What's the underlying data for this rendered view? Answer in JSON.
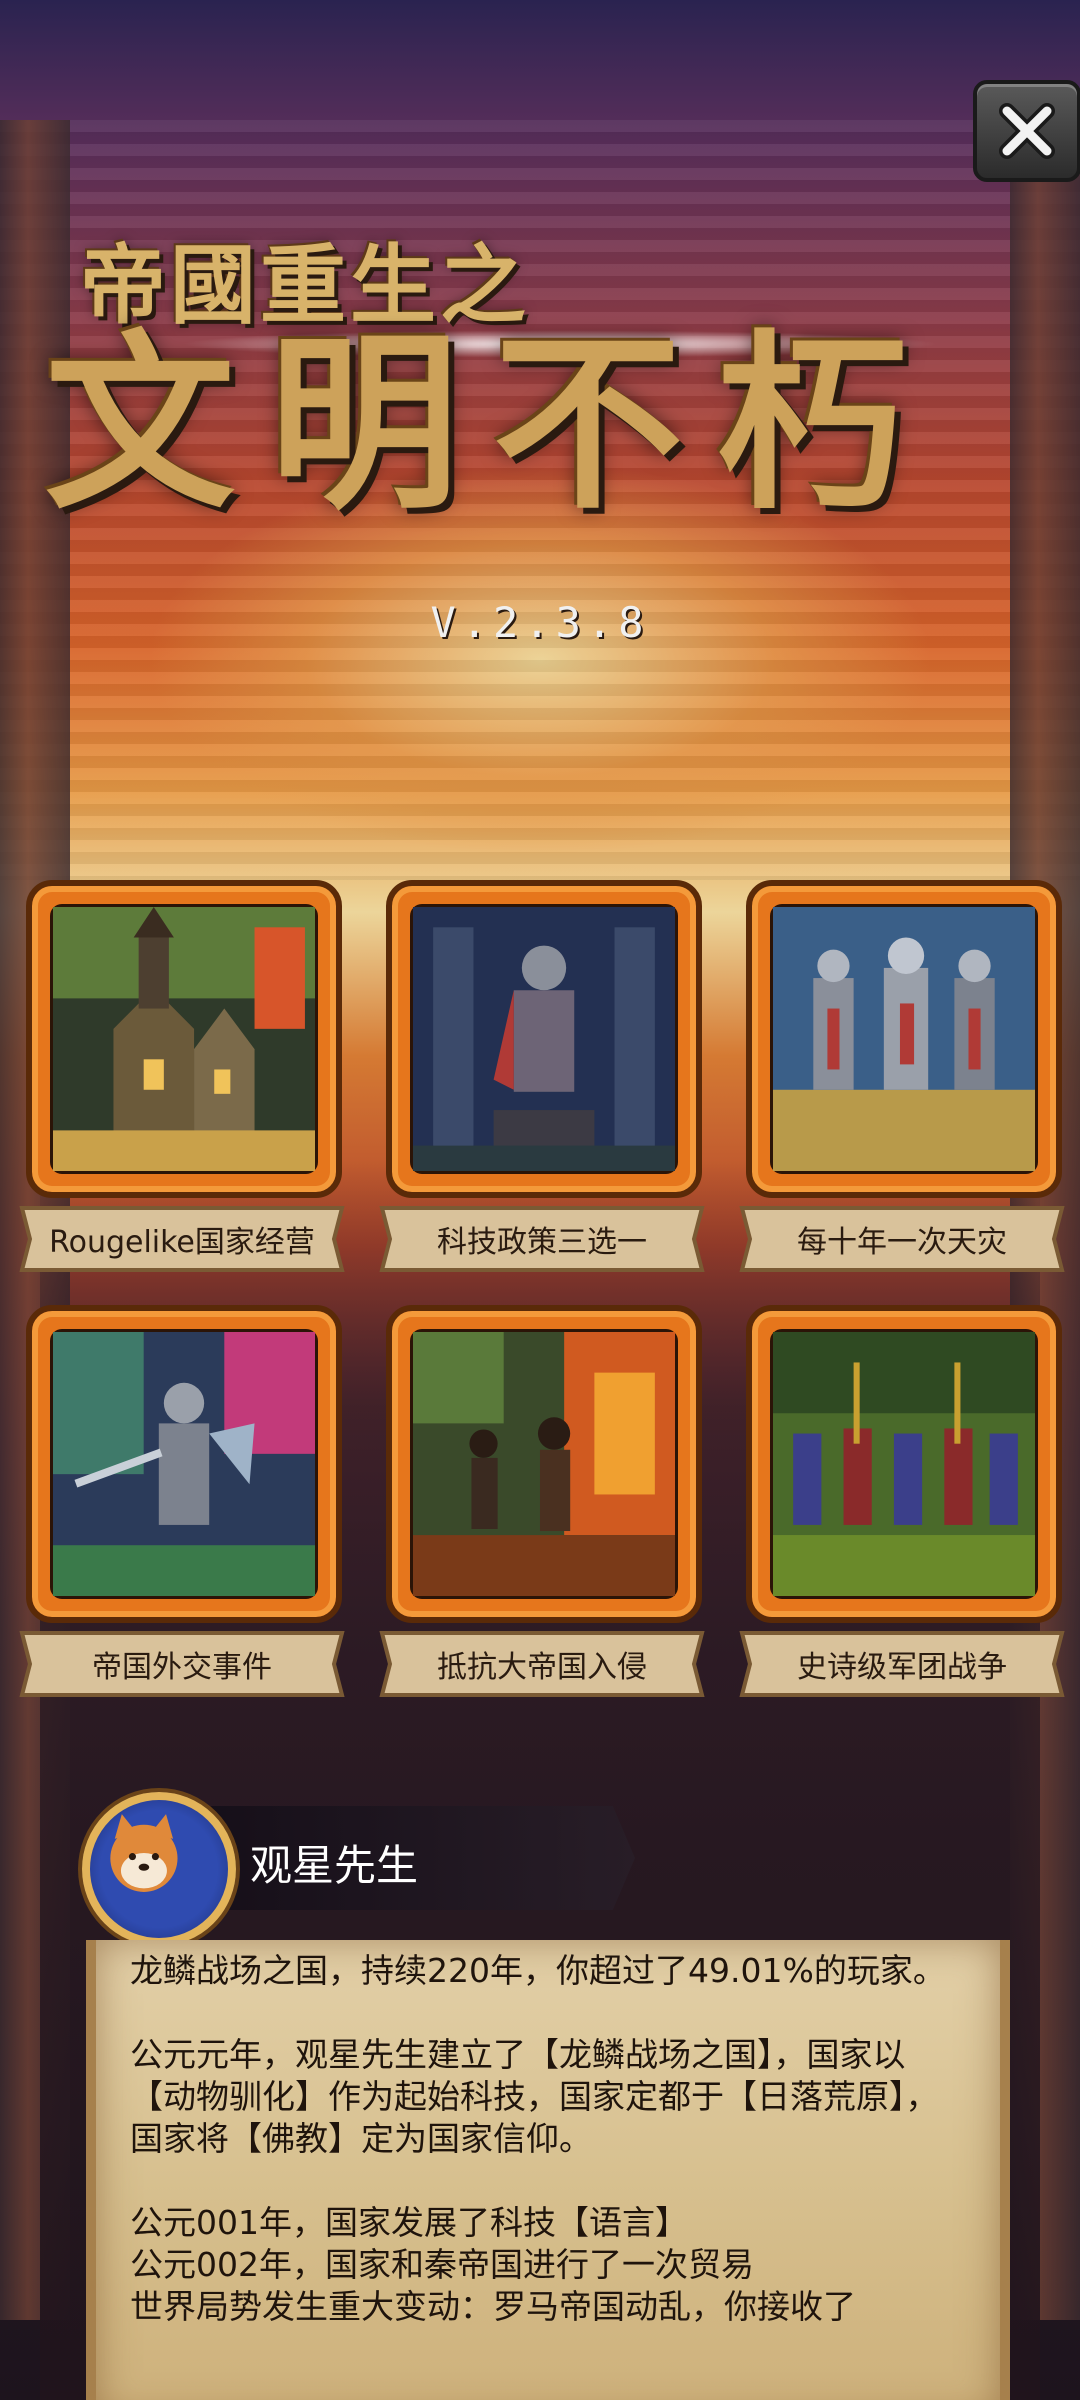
{
  "header": {
    "subtitle": "帝國重生之",
    "title": "文明不朽",
    "version": "V.2.3.8"
  },
  "close_icon": "close-x-icon",
  "features": [
    {
      "label": "Rougelike国家经营",
      "image": "medieval-town-illustration"
    },
    {
      "label": "科技政策三选一",
      "image": "statue-illustration"
    },
    {
      "label": "每十年一次天灾",
      "image": "knights-charge-illustration"
    },
    {
      "label": "帝国外交事件",
      "image": "armored-knight-illustration"
    },
    {
      "label": "抵抗大帝国入侵",
      "image": "burning-city-illustration"
    },
    {
      "label": "史诗级军团战争",
      "image": "army-march-illustration"
    }
  ],
  "player": {
    "name": "观星先生",
    "avatar": "shiba-dog-avatar"
  },
  "story": {
    "summary": "龙鳞战场之国，持续220年，你超过了49.01%的玩家。",
    "founding": "公元元年，观星先生建立了【龙鳞战场之国】，国家以【动物驯化】作为起始科技，国家定都于【日落荒原】，国家将【佛教】定为国家信仰。",
    "events": [
      "公元001年，国家发展了科技【语言】",
      "公元002年，国家和秦帝国进行了一次贸易",
      "世界局势发生重大变动：罗马帝国动乱，你接收了"
    ]
  },
  "colors": {
    "frame_orange": "#e6761c",
    "title_gold": "#cda25a",
    "parchment": "#d7c08f"
  }
}
